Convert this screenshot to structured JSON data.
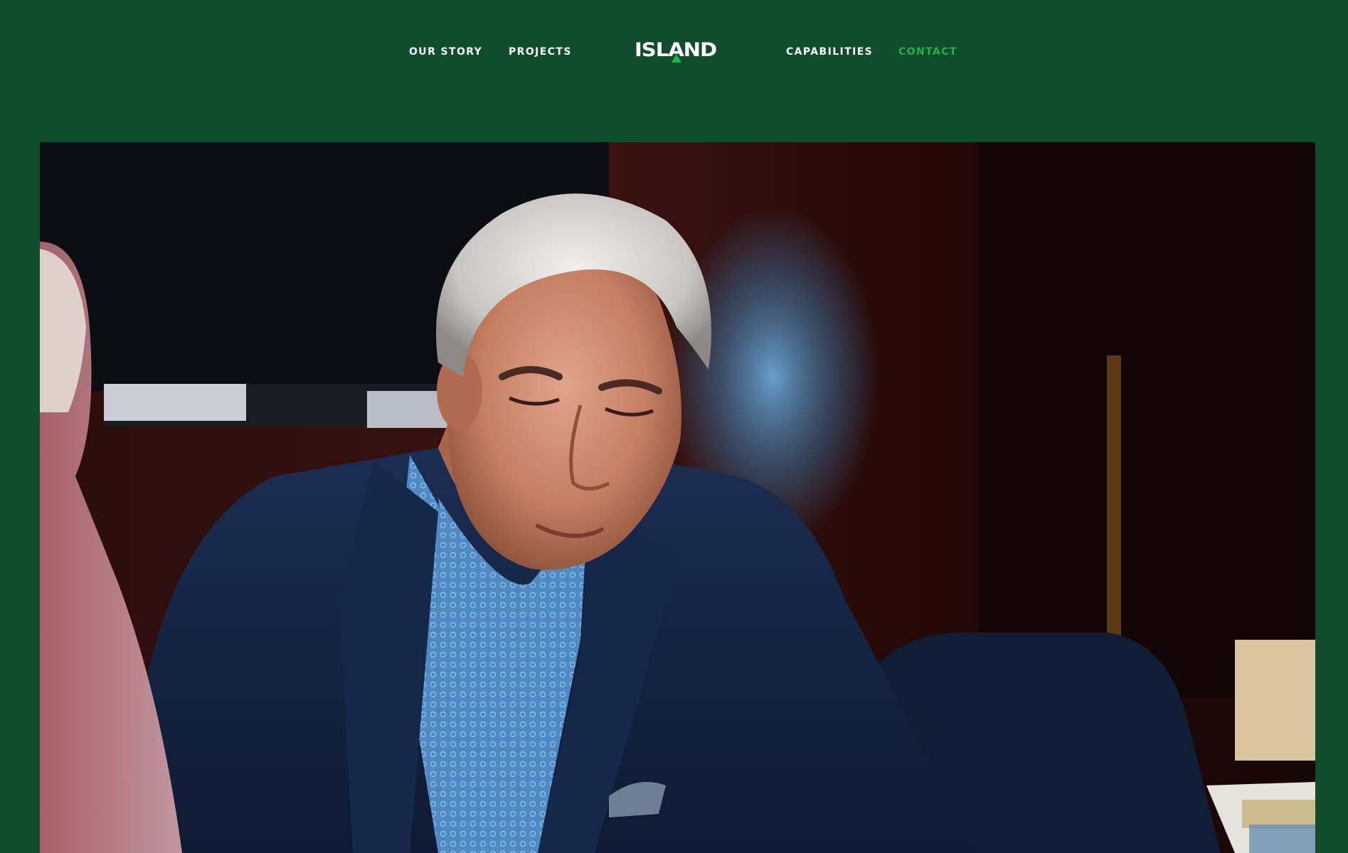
{
  "nav": {
    "our_story": "OUR STORY",
    "projects": "PROJECTS",
    "capabilities": "CAPABILITIES",
    "contact": "CONTACT"
  },
  "logo": {
    "text": "ISLAND",
    "mark_icon": "triangle-icon"
  },
  "colors": {
    "background": "#114d2d",
    "nav_text": "#ffffff",
    "accent": "#22b14c"
  },
  "hero": {
    "image_subject": "photo"
  }
}
